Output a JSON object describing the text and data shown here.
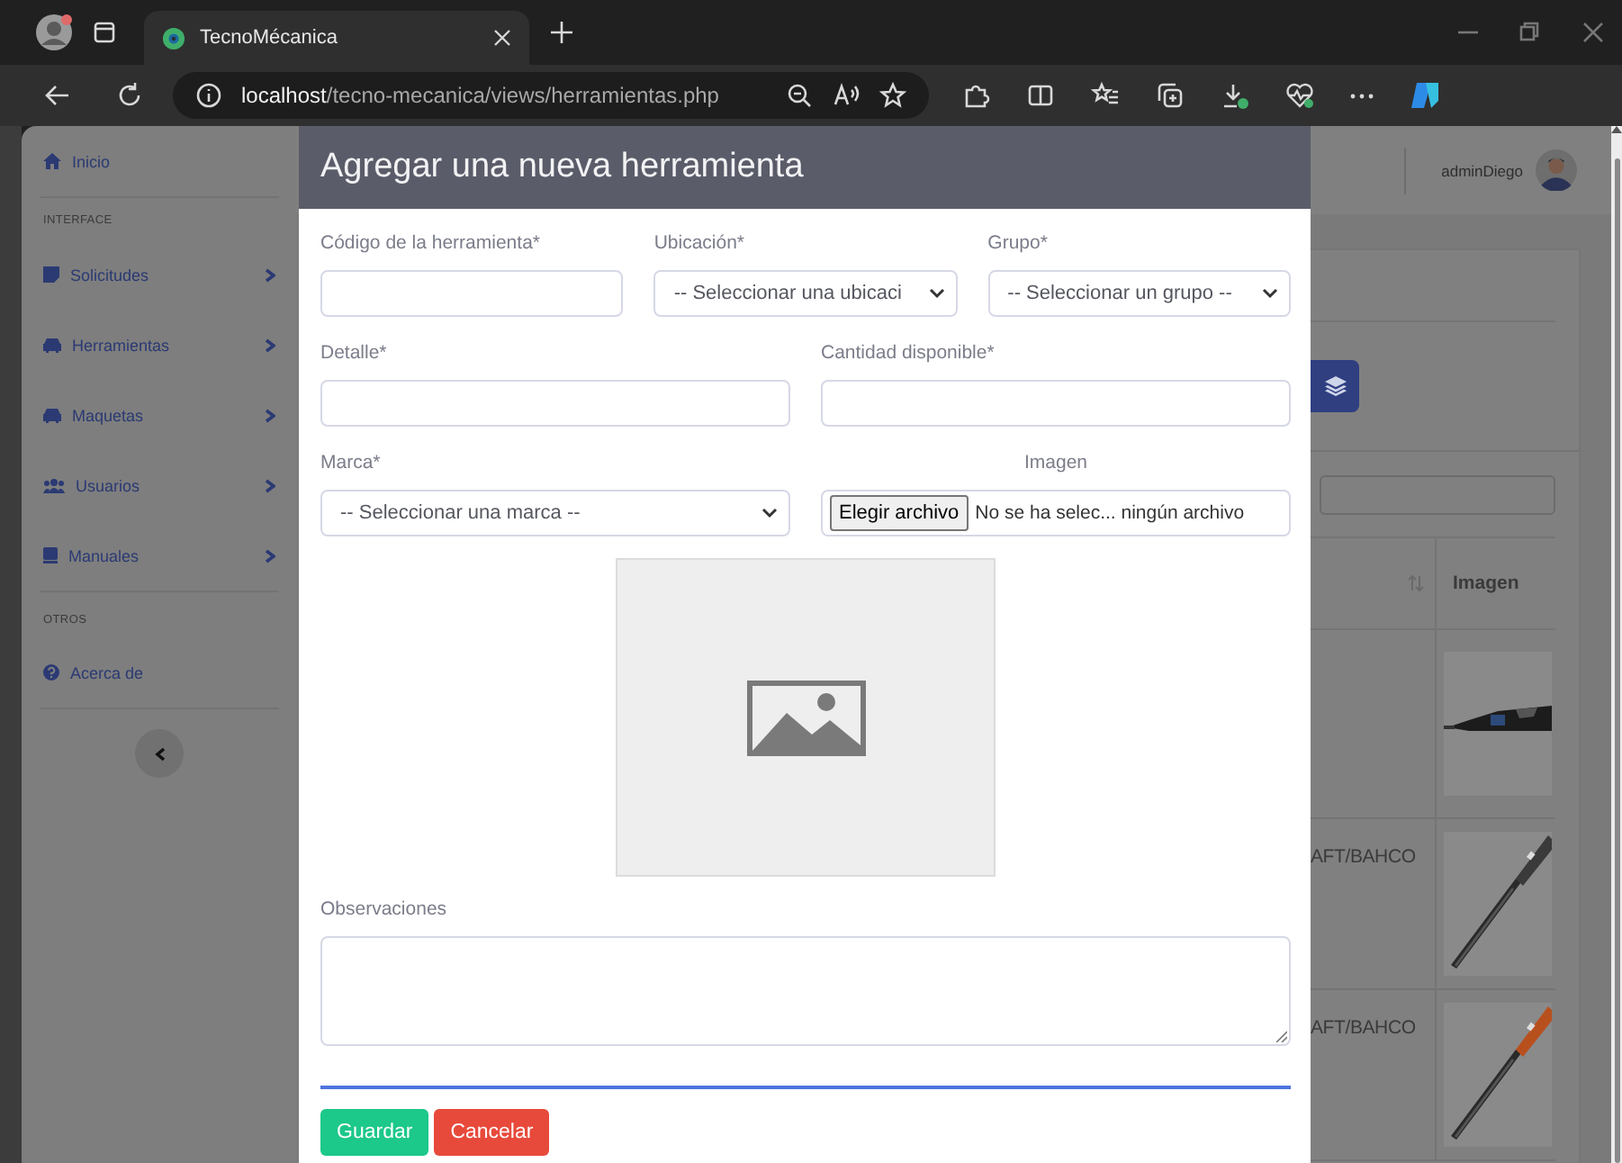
{
  "browser": {
    "tab_title": "TecnoMécanica",
    "url_host": "localhost",
    "url_path": "/tecno-mecanica/views/herramientas.php"
  },
  "sidebar": {
    "home": {
      "label": "Inicio"
    },
    "sections": [
      {
        "heading": "INTERFACE",
        "items": [
          {
            "label": "Solicitudes",
            "expanded": false
          },
          {
            "label": "Herramientas",
            "expanded": false
          },
          {
            "label": "Maquetas",
            "expanded": false
          },
          {
            "label": "Usuarios",
            "expanded": false
          },
          {
            "label": "Manuales",
            "expanded": false
          }
        ]
      },
      {
        "heading": "OTROS",
        "items": [
          {
            "label": "Acerca de"
          }
        ]
      }
    ]
  },
  "topbar": {
    "user_name": "adminDiego"
  },
  "table": {
    "columns": [
      {
        "sortable": true
      },
      {
        "label": "Imagen"
      }
    ],
    "rows": [
      {
        "image": {
          "kind": "picture"
        }
      },
      {
        "column_1": "AFT/BAHCO",
        "image": {
          "kind": "picture"
        }
      },
      {
        "column_1": "AFT/BAHCO",
        "image": {
          "kind": "picture"
        }
      }
    ]
  },
  "modal": {
    "title": "Agregar una nueva herramienta",
    "rows": [
      [
        {
          "kind": "text",
          "label": "Código de la herramienta*"
        },
        {
          "kind": "select",
          "label": "Ubicación*",
          "value": "-- Seleccionar una ubicaci"
        },
        {
          "kind": "select",
          "label": "Grupo*",
          "value": "-- Seleccionar un grupo --"
        }
      ],
      [
        {
          "kind": "text",
          "label": "Detalle*"
        },
        {
          "kind": "text",
          "label": "Cantidad disponible*"
        }
      ],
      [
        {
          "kind": "select",
          "label": "Marca*",
          "value": "-- Seleccionar una marca --"
        },
        {
          "kind": "file",
          "label": "Imagen",
          "button": "Elegir archivo",
          "status": "No se ha selec... ningún archivo"
        }
      ]
    ],
    "notes": {
      "label": "Observaciones"
    },
    "buttons": [
      {
        "kind": "primary",
        "label": "Guardar"
      },
      {
        "kind": "danger",
        "label": "Cancelar"
      }
    ]
  }
}
